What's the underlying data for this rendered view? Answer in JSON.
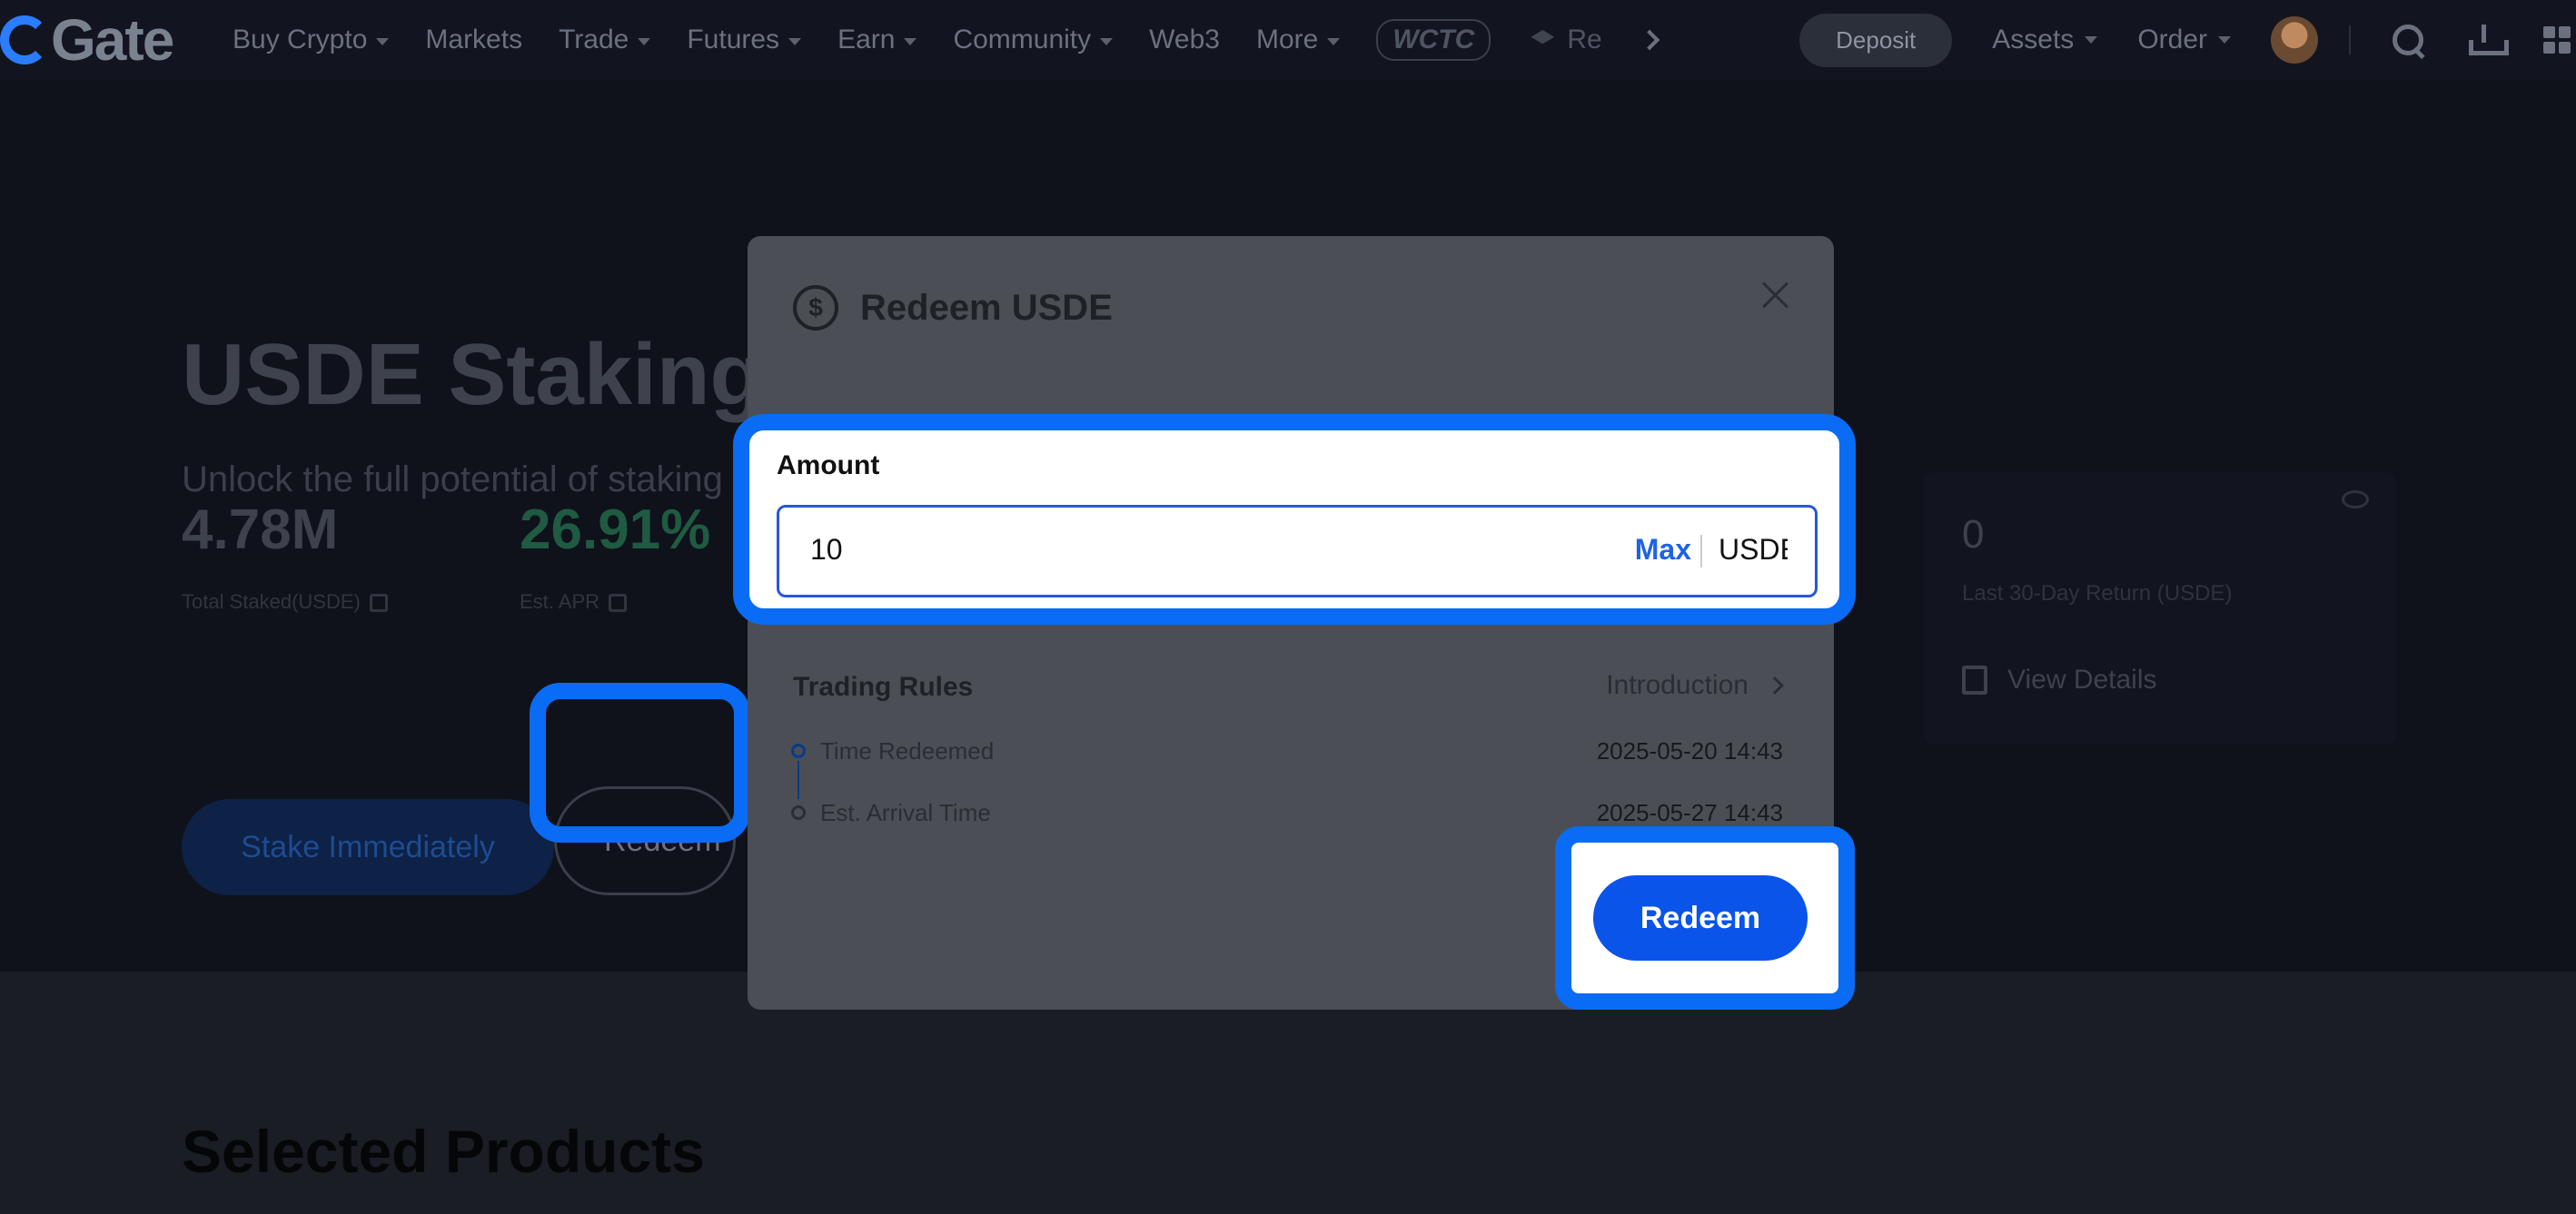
{
  "nav": {
    "logo": "Gate",
    "items": [
      {
        "label": "Buy Crypto",
        "dropdown": true
      },
      {
        "label": "Markets",
        "dropdown": false
      },
      {
        "label": "Trade",
        "dropdown": true
      },
      {
        "label": "Futures",
        "dropdown": true
      },
      {
        "label": "Earn",
        "dropdown": true
      },
      {
        "label": "Community",
        "dropdown": true
      },
      {
        "label": "Web3",
        "dropdown": false
      },
      {
        "label": "More",
        "dropdown": true
      }
    ],
    "promo_badge": "WCTC",
    "truncated_item": "Re",
    "deposit_label": "Deposit",
    "assets_label": "Assets",
    "order_label": "Order"
  },
  "hero": {
    "title": "USDE Staking",
    "subtitle": "Unlock the full potential of staking",
    "total_staked_value": "4.78M",
    "total_staked_label": "Total Staked(USDE)",
    "apr_value": "26.91%",
    "apr_label": "Est. APR",
    "stake_button": "Stake Immediately",
    "redeem_button": "Redeem",
    "return_value": "0",
    "return_label": "Last 30-Day Return (USDE)",
    "view_details": "View Details"
  },
  "lower": {
    "section_title": "Selected Products"
  },
  "modal": {
    "title": "Redeem USDE",
    "amount_label": "Amount",
    "amount_value": "10",
    "max_label": "Max",
    "currency": "USDE",
    "rules_title": "Trading Rules",
    "rules_link": "Introduction",
    "timeline": [
      {
        "label": "Time Redeemed",
        "value": "2025-05-20 14:43"
      },
      {
        "label": "Est. Arrival Time",
        "value": "2025-05-27 14:43"
      }
    ],
    "redeem_button": "Redeem"
  },
  "colors": {
    "highlight": "#0a6cf5",
    "primary_button": "#0a54ea",
    "apr_green": "#1f7a52"
  }
}
